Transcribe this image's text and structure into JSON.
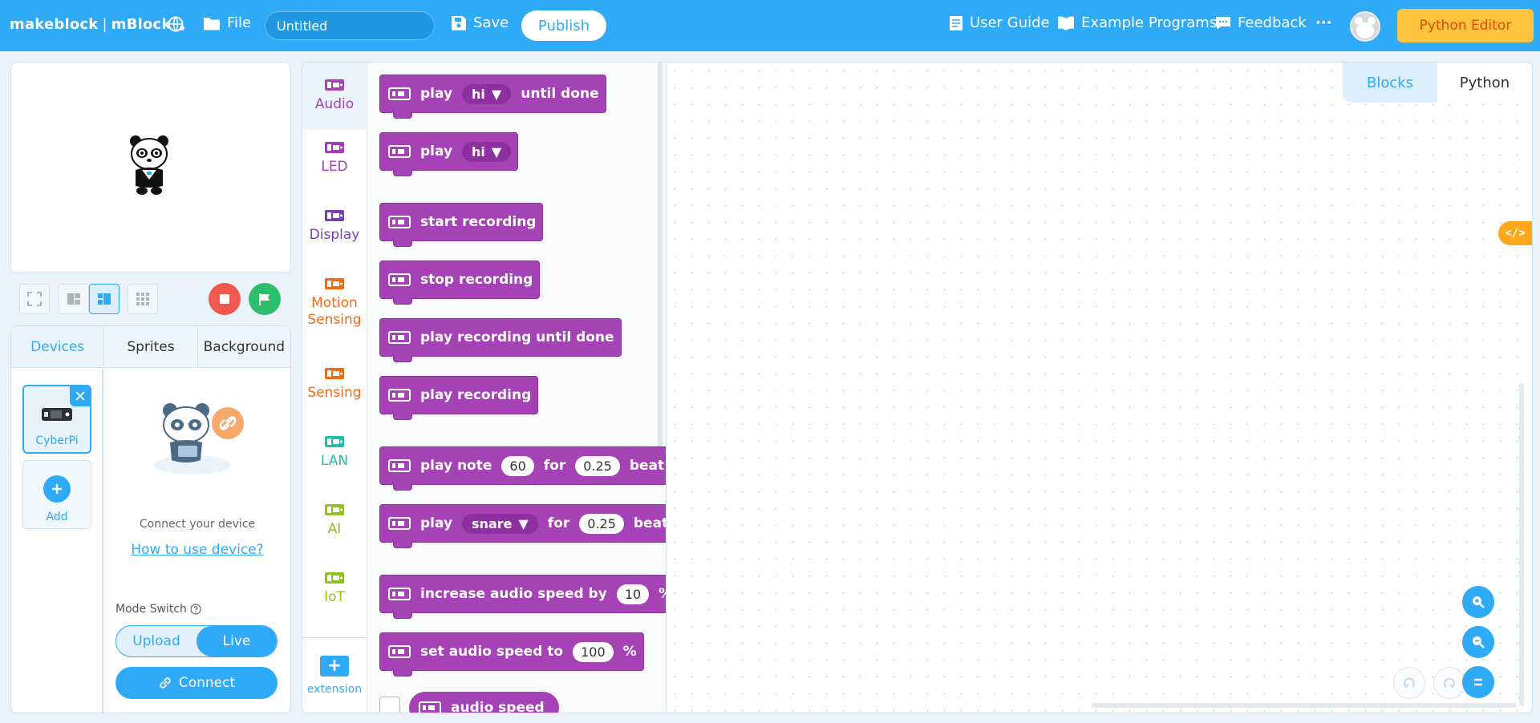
{
  "topbar": {
    "brand_left": "makeblock",
    "brand_right": "mBlock",
    "file_label": "File",
    "project_title": "Untitled",
    "save_label": "Save",
    "publish_label": "Publish",
    "user_guide_label": "User Guide",
    "example_programs_label": "Example Programs",
    "feedback_label": "Feedback",
    "more_label": "···",
    "python_editor_label": "Python Editor"
  },
  "devices_panel": {
    "tabs": [
      {
        "label": "Devices"
      },
      {
        "label": "Sprites"
      },
      {
        "label": "Background"
      }
    ],
    "devices": [
      {
        "label": "CyberPi"
      },
      {
        "label": "Add"
      }
    ],
    "connect_text": "Connect your device",
    "how_to_link": "How to use device?",
    "mode_switch_label": "Mode Switch",
    "mode_options": [
      "Upload",
      "Live"
    ],
    "mode_selected": "Live",
    "connect_label": "Connect"
  },
  "categories": [
    {
      "label": "Audio",
      "color": "#a542b6"
    },
    {
      "label": "LED",
      "color": "#a23bc2"
    },
    {
      "label": "Display",
      "color": "#7a3fb5"
    },
    {
      "label": "Motion Sensing",
      "color": "#f06b12"
    },
    {
      "label": "Sensing",
      "color": "#f06b12"
    },
    {
      "label": "LAN",
      "color": "#1ebfaa"
    },
    {
      "label": "AI",
      "color": "#8dc21f"
    },
    {
      "label": "IoT",
      "color": "#8dc21f"
    }
  ],
  "extension_label": "extension",
  "blocks": {
    "b1": {
      "play": "play",
      "sound": "hi",
      "until": "until done"
    },
    "b2": {
      "play": "play",
      "sound": "hi"
    },
    "b3": {
      "text": "start recording"
    },
    "b4": {
      "text": "stop recording"
    },
    "b5": {
      "text": "play recording until done"
    },
    "b6": {
      "text": "play recording"
    },
    "b7": {
      "a": "play note",
      "note": "60",
      "b": "for",
      "beats": "0.25",
      "c": "beat"
    },
    "b8": {
      "a": "play",
      "drum": "snare",
      "b": "for",
      "beats": "0.25",
      "c": "beat"
    },
    "b9": {
      "a": "increase audio speed by",
      "value": "10",
      "unit": "%"
    },
    "b10": {
      "a": "set audio speed to",
      "value": "100",
      "unit": "%"
    },
    "b11": {
      "text": "audio speed"
    }
  },
  "workspace": {
    "tabs": [
      "Blocks",
      "Python"
    ],
    "active_tab": "Blocks",
    "code_toggle": "</>"
  },
  "colors": {
    "brand": "#2eaaf6",
    "audio_block": "#a542b6",
    "python_editor_bg": "#ffc43d",
    "stop": "#f0594f",
    "go": "#2dbe6c"
  }
}
